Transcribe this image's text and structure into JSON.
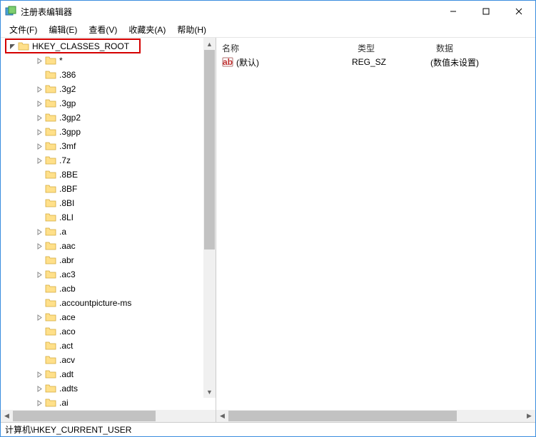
{
  "window": {
    "title": "注册表编辑器"
  },
  "menu": {
    "file": "文件(F)",
    "edit": "编辑(E)",
    "view": "查看(V)",
    "favorites": "收藏夹(A)",
    "help": "帮助(H)"
  },
  "tree": {
    "root": {
      "label": "HKEY_CLASSES_ROOT",
      "expanded": true,
      "expandable": true,
      "highlighted": true,
      "indent": 10
    },
    "items": [
      {
        "label": "*",
        "expandable": true
      },
      {
        "label": ".386",
        "expandable": false
      },
      {
        "label": ".3g2",
        "expandable": true
      },
      {
        "label": ".3gp",
        "expandable": true
      },
      {
        "label": ".3gp2",
        "expandable": true
      },
      {
        "label": ".3gpp",
        "expandable": true
      },
      {
        "label": ".3mf",
        "expandable": true
      },
      {
        "label": ".7z",
        "expandable": true
      },
      {
        "label": ".8BE",
        "expandable": false
      },
      {
        "label": ".8BF",
        "expandable": false
      },
      {
        "label": ".8BI",
        "expandable": false
      },
      {
        "label": ".8LI",
        "expandable": false
      },
      {
        "label": ".a",
        "expandable": true
      },
      {
        "label": ".aac",
        "expandable": true
      },
      {
        "label": ".abr",
        "expandable": false
      },
      {
        "label": ".ac3",
        "expandable": true
      },
      {
        "label": ".acb",
        "expandable": false
      },
      {
        "label": ".accountpicture-ms",
        "expandable": false
      },
      {
        "label": ".ace",
        "expandable": true
      },
      {
        "label": ".aco",
        "expandable": false
      },
      {
        "label": ".act",
        "expandable": false
      },
      {
        "label": ".acv",
        "expandable": false
      },
      {
        "label": ".adt",
        "expandable": true
      },
      {
        "label": ".adts",
        "expandable": true
      },
      {
        "label": ".ai",
        "expandable": true
      }
    ]
  },
  "list": {
    "headers": {
      "name": "名称",
      "type": "类型",
      "data": "数据"
    },
    "rows": [
      {
        "name": "(默认)",
        "type": "REG_SZ",
        "data": "(数值未设置)"
      }
    ]
  },
  "statusbar": {
    "path": "计算机\\HKEY_CURRENT_USER"
  }
}
